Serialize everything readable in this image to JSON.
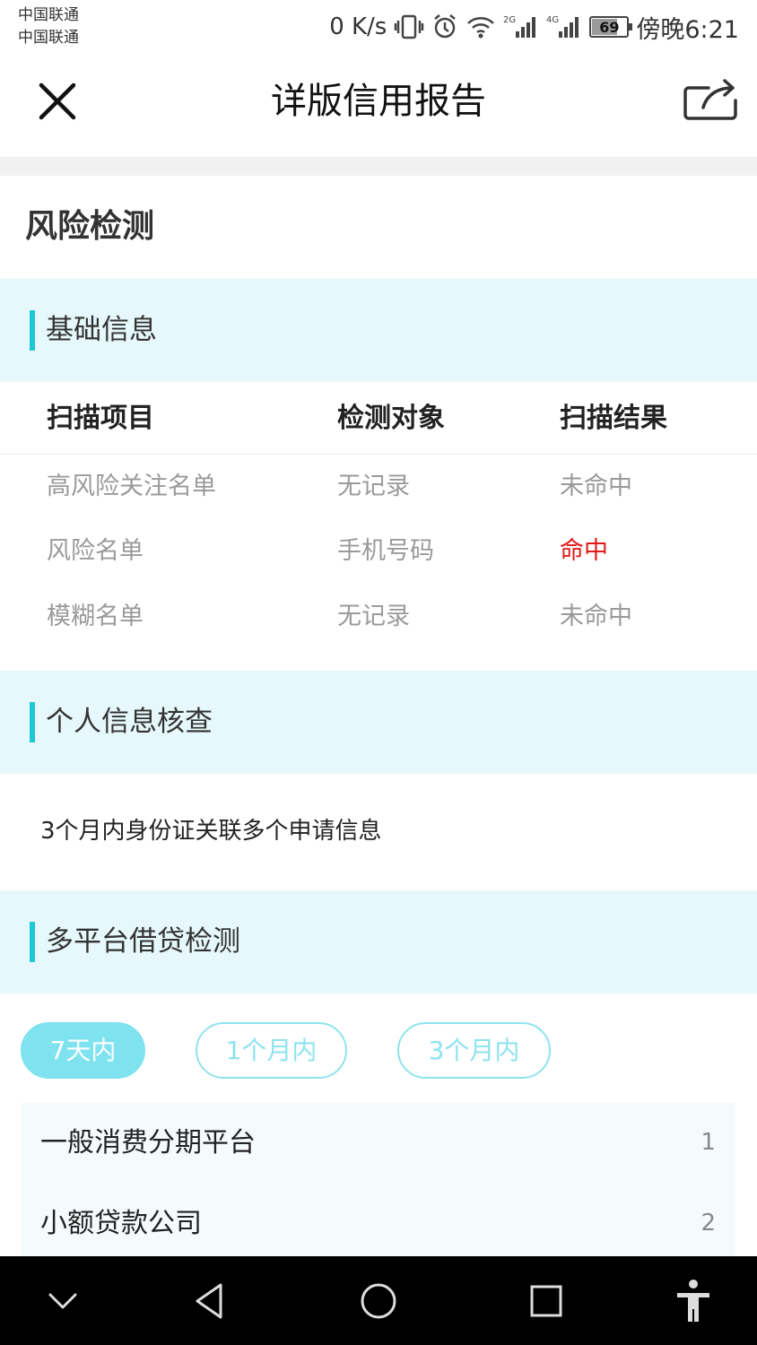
{
  "status_bar": {
    "carrier_1": "中国联通",
    "carrier_2": "中国联通",
    "net_speed": "0 K/s",
    "signal_1_label": "2G",
    "signal_2_label": "4G",
    "battery_level": "69",
    "time": "傍晚6:21"
  },
  "nav": {
    "title": "详版信用报告",
    "close_icon": "close-icon",
    "share_icon": "share-icon"
  },
  "page": {
    "title": "风险检测"
  },
  "basic_info": {
    "section_title": "基础信息",
    "headers": [
      "扫描项目",
      "检测对象",
      "扫描结果"
    ],
    "rows": [
      {
        "item": "高风险关注名单",
        "target": "无记录",
        "result": "未命中"
      },
      {
        "item": "风险名单",
        "target": "手机号码",
        "result": "命中"
      },
      {
        "item": "模糊名单",
        "target": "无记录",
        "result": "未命中"
      }
    ]
  },
  "personal_check": {
    "section_title": "个人信息核查",
    "text": "3个月内身份证关联多个申请信息"
  },
  "multi_platform": {
    "section_title": "多平台借贷检测",
    "tabs": [
      {
        "label": "7天内",
        "active": true
      },
      {
        "label": "1个月内",
        "active": false
      },
      {
        "label": "3个月内",
        "active": false
      }
    ],
    "platforms": [
      {
        "name": "一般消费分期平台",
        "count": "1"
      },
      {
        "name": "小额贷款公司",
        "count": "2"
      }
    ]
  },
  "colors": {
    "accent": "#1cc8d6",
    "section_bg": "#e6f8fb",
    "hit_red": "#e01a1a",
    "muted_text": "#9a9a9a"
  }
}
